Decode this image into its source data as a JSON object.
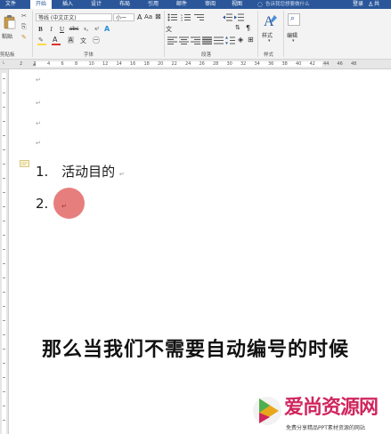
{
  "tabs": [
    {
      "label": "文件"
    },
    {
      "label": "开始",
      "active": true
    },
    {
      "label": "插入"
    },
    {
      "label": "设计"
    },
    {
      "label": "布局"
    },
    {
      "label": "引用"
    },
    {
      "label": "邮件"
    },
    {
      "label": "审阅"
    },
    {
      "label": "视图"
    }
  ],
  "tell_me": "告诉我您想要做什么",
  "login": "登录",
  "share": "共",
  "ribbon": {
    "paste_label": "粘贴",
    "font_name": "等线 (中文正文)",
    "font_size": "小一",
    "groups": {
      "clipboard": "剪贴板",
      "font": "字体",
      "paragraph": "段落",
      "styles": "样式",
      "editing": "编辑"
    },
    "styles_label": "样式",
    "editing_label": "编辑",
    "format_buttons": [
      "B",
      "I",
      "U",
      "abc",
      "x₂",
      "x²"
    ],
    "accent_colors": {
      "highlight": "#ffd84d",
      "font_color": "#e03030",
      "styles": "#2b579a"
    }
  },
  "ruler": {
    "numbers": [
      "2",
      "2",
      "4",
      "6",
      "8",
      "10",
      "12",
      "14",
      "16",
      "18",
      "20",
      "22",
      "24",
      "26",
      "28",
      "30",
      "32",
      "34",
      "36",
      "38",
      "40",
      "42",
      "44",
      "46",
      "48"
    ]
  },
  "document": {
    "empty_paragraph_marks": [
      "↵",
      "↵",
      "↵",
      "↵"
    ],
    "list_items": [
      {
        "number": "1.",
        "text": "活动目的",
        "mark": "↵"
      },
      {
        "number": "2.",
        "text": "",
        "mark": "↵"
      }
    ]
  },
  "subtitle": "那么当我们不需要自动编号的时候",
  "watermark": {
    "title": "爱尚资源网",
    "subtitle": "免费分享精品PPT素材资源的网站"
  }
}
